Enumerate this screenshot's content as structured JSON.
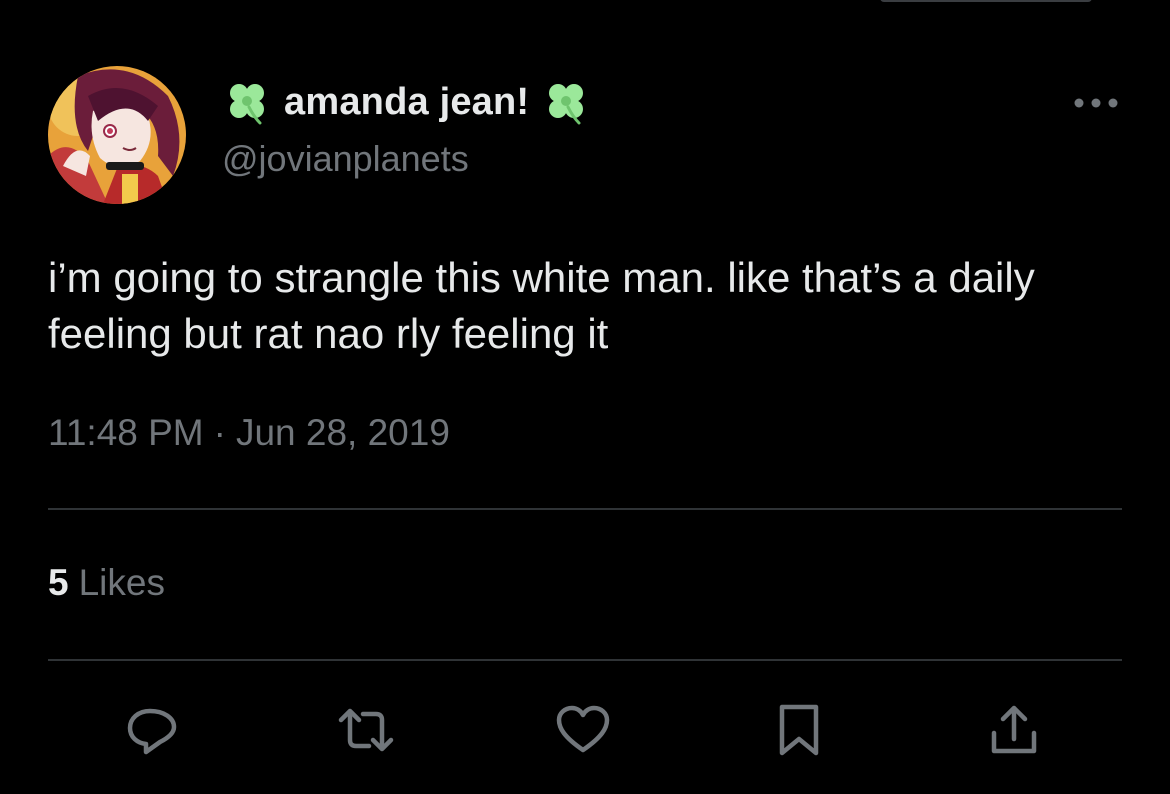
{
  "colors": {
    "background": "#000000",
    "primary_text": "#e7e9ea",
    "secondary_text": "#71767b",
    "divider": "#2f3336",
    "clover": "#9be89a"
  },
  "author": {
    "display_name": "amanda jean!",
    "handle": "@jovianplanets",
    "name_emoji": "four-leaf-clover"
  },
  "tweet": {
    "text": "i’m going to strangle this white man. like that’s a daily feeling but rat nao rly feeling it",
    "time": "11:48 PM",
    "separator": "·",
    "date": "Jun 28, 2019"
  },
  "engagement": {
    "likes_count": "5",
    "likes_label": "Likes"
  },
  "actions": [
    {
      "name": "reply",
      "icon": "reply-icon"
    },
    {
      "name": "retweet",
      "icon": "retweet-icon"
    },
    {
      "name": "like",
      "icon": "heart-icon"
    },
    {
      "name": "bookmark",
      "icon": "bookmark-icon"
    },
    {
      "name": "share",
      "icon": "share-icon"
    }
  ]
}
